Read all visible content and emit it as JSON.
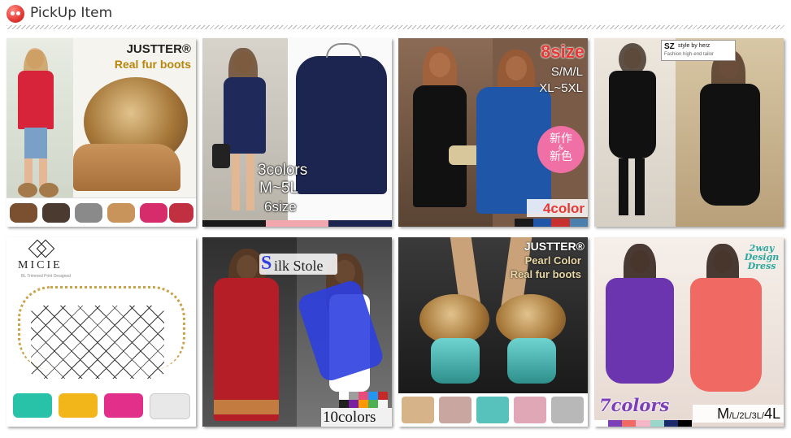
{
  "header": {
    "title": "PickUp Item",
    "icon": "red-face-icon"
  },
  "tiles": [
    {
      "brand": "JUSTTER®",
      "subtitle": "Real fur boots",
      "accent": "#b8860b"
    },
    {
      "line1": "3colors",
      "line2": "M~5L",
      "line3": "6size",
      "colors": [
        "#1a1a1a",
        "#f2a7ae",
        "#1c2550"
      ]
    },
    {
      "size_count": "8size",
      "size_range1": "S/M/L",
      "size_range2": "XL~5XL",
      "badge_line1": "新作",
      "badge_amp": "&",
      "badge_line2": "新色",
      "colors_label": "4color",
      "colors": [
        "#1a1a1a",
        "#1f56a8",
        "#c8302f",
        "#4a7fae"
      ]
    },
    {
      "logo": "SZ",
      "logo_text": "style by herz",
      "tagline": "Fashion high-end tailor"
    },
    {
      "brand": "MICIE",
      "brand_tag": "BL Trimmed Print Designed",
      "colors": [
        "#27c2a7",
        "#f2b51a",
        "#e2308a",
        "#e8e8e8"
      ]
    },
    {
      "title_big": "S",
      "title_rest": "ilk Stole",
      "colors_label": "10colors",
      "colors": [
        "#ffffff",
        "#9e9e9e",
        "#e74c7a",
        "#2196f3",
        "#c62828",
        "#212121",
        "#7b1fa2",
        "#ff9800",
        "#4caf50",
        "#f5f5f5"
      ]
    },
    {
      "brand": "JUSTTER®",
      "line1": "Pearl Color",
      "line2": "Real fur boots"
    },
    {
      "corner1": "2way",
      "corner2": "Design",
      "corner3": "Dress",
      "colors_label": "7colors",
      "sizes_M": "M",
      "sizes_mid": "/L/2L/3L/",
      "sizes_4L": "4L",
      "colors": [
        "#ffffff",
        "#7b3fb8",
        "#f06a63",
        "#f7b6c8",
        "#9ad5c9",
        "#1b2a6b",
        "#000000"
      ]
    }
  ]
}
